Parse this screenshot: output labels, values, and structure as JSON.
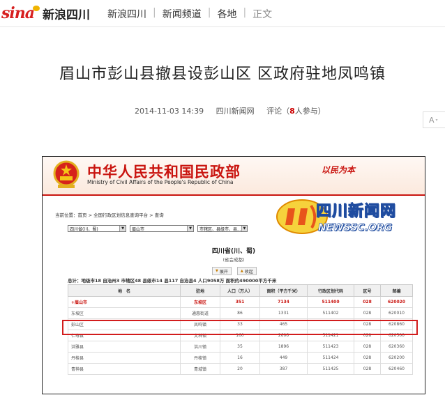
{
  "site": {
    "logo_brand": "sina",
    "logo_label": "新浪四川"
  },
  "breadcrumb": [
    {
      "label": "新浪四川"
    },
    {
      "label": "新闻频道"
    },
    {
      "label": "各地"
    },
    {
      "label": "正文"
    }
  ],
  "breadcrumb_separator": "|",
  "article": {
    "title": "眉山市彭山县撤县设彭山区 区政府驻地凤鸣镇",
    "date": "2014-11-03 14:39",
    "source": "四川新闻网",
    "comment_prefix": "评论（",
    "comment_count": "8",
    "comment_suffix": "人参与）",
    "font_button": "A"
  },
  "embedded_screenshot": {
    "header_cn": "中华人民共和国民政部",
    "header_en": "Ministry of Civil Affairs of the People's Republic of China",
    "slogan": "以民为本",
    "location_crumb": "当前位置：首页 > 全国行政区划信息查询平台 > 查询",
    "selects": [
      {
        "value": "四川省(川、蜀)"
      },
      {
        "value": "眉山市"
      },
      {
        "value": "市辖区、县级市、县..."
      }
    ],
    "watermark_cn": "四川新闻网",
    "watermark_en": "NEWSSC.ORG",
    "province_title": "四川省(川、蜀)",
    "province_capital": "(省会成都)",
    "expand_label": "展开",
    "collapse_label": "收起",
    "stats_line": "总计：地级市18  自治州3  市辖区48  县级市14  县117  自治县4  人口9058万  面积约490000平方千米",
    "columns": [
      "地　名",
      "驻地",
      "人口（万人）",
      "面积（平方千米）",
      "行政区划代码",
      "区号",
      "邮编"
    ],
    "rows": [
      {
        "name": "+眉山市",
        "seat": "东坡区",
        "pop": "351",
        "area": "7134",
        "code": "511400",
        "tel": "028",
        "zip": "620020",
        "type": "city"
      },
      {
        "name": "东坡区",
        "seat": "通惠街道",
        "pop": "86",
        "area": "1331",
        "code": "511402",
        "tel": "028",
        "zip": "620010",
        "type": "row"
      },
      {
        "name": "彭山区",
        "seat": "凤鸣镇",
        "pop": "33",
        "area": "465",
        "code": "",
        "tel": "028",
        "zip": "620860",
        "type": "highlight"
      },
      {
        "name": "仁寿县",
        "seat": "文林镇",
        "pop": "160",
        "area": "2606",
        "code": "511421",
        "tel": "028",
        "zip": "620500",
        "type": "row"
      },
      {
        "name": "洪雅县",
        "seat": "洪川镇",
        "pop": "35",
        "area": "1896",
        "code": "511423",
        "tel": "028",
        "zip": "620360",
        "type": "row"
      },
      {
        "name": "丹棱县",
        "seat": "丹棱镇",
        "pop": "16",
        "area": "449",
        "code": "511424",
        "tel": "028",
        "zip": "620200",
        "type": "row"
      },
      {
        "name": "青神县",
        "seat": "青城镇",
        "pop": "20",
        "area": "387",
        "code": "511425",
        "tel": "028",
        "zip": "620460",
        "type": "row"
      }
    ]
  }
}
